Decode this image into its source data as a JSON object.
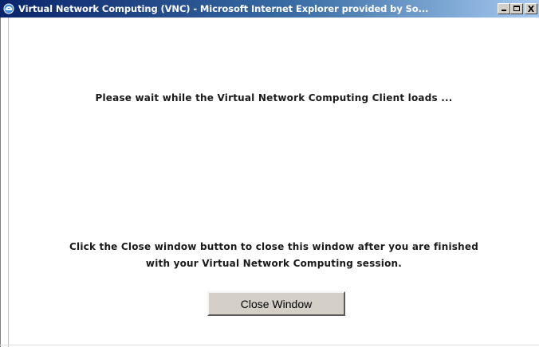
{
  "window": {
    "title": "Virtual Network Computing (VNC) - Microsoft Internet Explorer provided by So...",
    "icon": "ie-icon",
    "controls": {
      "minimize": "minimize-icon",
      "maximize": "maximize-icon",
      "close_glyph": "X"
    }
  },
  "content": {
    "wait_message": "Please wait while the Virtual Network Computing Client loads ...",
    "close_message_line1": "Click the Close window button to close this window after you are finished",
    "close_message_line2": "with your Virtual Network Computing session.",
    "close_button_label": "Close Window"
  },
  "colors": {
    "titlebar_start": "#0a246a",
    "titlebar_end": "#a6caf0",
    "button_face": "#d4d0c8"
  }
}
